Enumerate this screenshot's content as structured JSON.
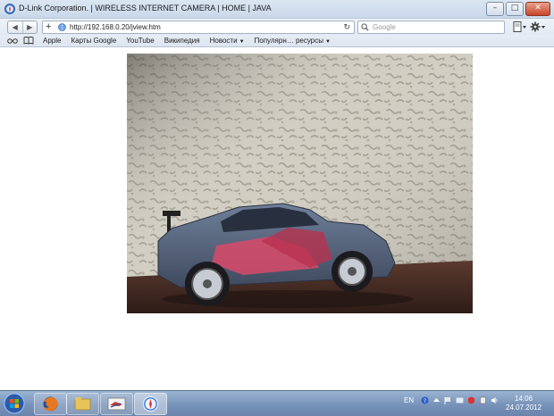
{
  "window": {
    "title": "D-Link Corporation. | WIRELESS INTERNET CAMERA | HOME | JAVA",
    "controls": {
      "minimize": "–",
      "maximize": "□",
      "close": "✕"
    }
  },
  "navbar": {
    "back": "◀",
    "forward": "▶",
    "add": "+",
    "url": "http://192.168.0.20/jview.htm",
    "reload": "↻",
    "search_placeholder": "Google"
  },
  "bookmarks": {
    "items": [
      {
        "label": "Apple",
        "dropdown": false
      },
      {
        "label": "Карты Google",
        "dropdown": false
      },
      {
        "label": "YouTube",
        "dropdown": false
      },
      {
        "label": "Википедия",
        "dropdown": false
      },
      {
        "label": "Новости",
        "dropdown": true
      },
      {
        "label": "Популярн… ресурсы",
        "dropdown": true
      }
    ]
  },
  "taskbar": {
    "apps": [
      "firefox-icon",
      "folder-icon",
      "app-window-icon",
      "safari-icon"
    ],
    "language": "EN",
    "time": "14:06",
    "date": "24.07.2012"
  }
}
